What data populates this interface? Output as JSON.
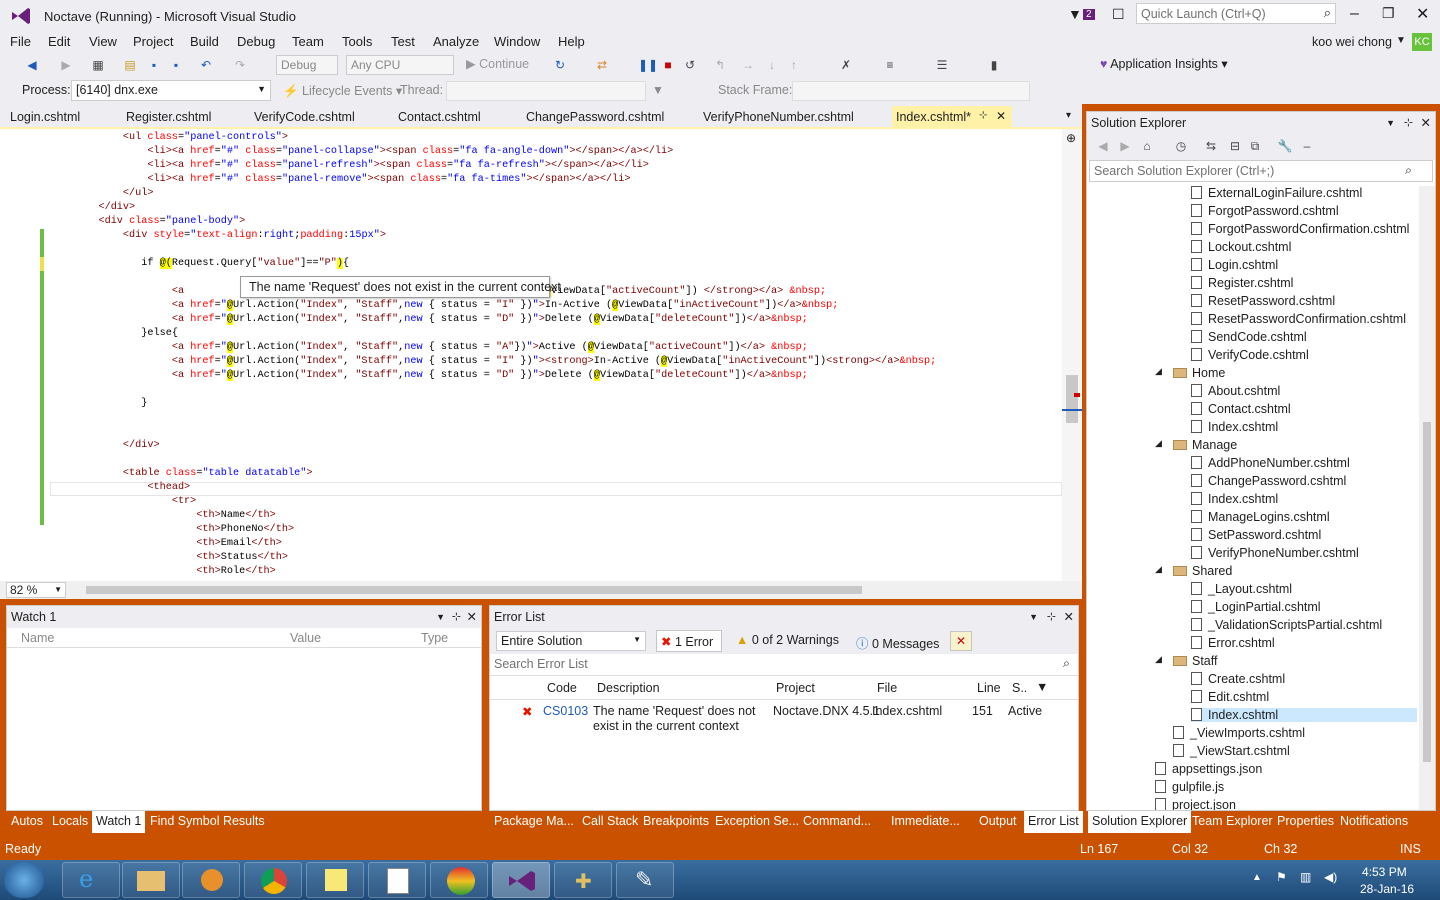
{
  "window": {
    "title": "Noctave (Running) - Microsoft Visual Studio",
    "notif_count": "2",
    "quick_launch": "Quick Launch (Ctrl+Q)",
    "user": "koo wei chong",
    "user_initials": "KC"
  },
  "menu": [
    "File",
    "Edit",
    "View",
    "Project",
    "Build",
    "Debug",
    "Team",
    "Tools",
    "Test",
    "Analyze",
    "Window",
    "Help"
  ],
  "toolbar": {
    "config": "Debug",
    "platform": "Any CPU",
    "continue": "Continue",
    "insights": "Application Insights"
  },
  "debugbar": {
    "process_label": "Process:",
    "process_value": "[6140] dnx.exe",
    "lifecycle": "Lifecycle Events",
    "thread_label": "Thread:",
    "stackframe_label": "Stack Frame:"
  },
  "doc_tabs": [
    "Login.cshtml",
    "Register.cshtml",
    "VerifyCode.cshtml",
    "Contact.cshtml",
    "ChangePassword.cshtml",
    "VerifyPhoneNumber.cshtml",
    "Index.cshtml*"
  ],
  "tooltip": "The name 'Request' does not exist in the current context",
  "zoom": "82 %",
  "watch": {
    "title": "Watch 1",
    "cols": [
      "Name",
      "Value",
      "Type"
    ]
  },
  "errors": {
    "title": "Error List",
    "scope": "Entire Solution",
    "errors_btn": "1 Error",
    "warnings_btn": "0 of 2 Warnings",
    "messages_btn": "0 Messages",
    "search": "Search Error List",
    "cols": [
      "Code",
      "Description",
      "Project",
      "File",
      "Line",
      "S.."
    ],
    "rows": [
      {
        "code": "CS0103",
        "desc1": "The name 'Request' does not",
        "desc2": "exist in the current context",
        "project": "Noctave.DNX 4.5.1",
        "file": "Index.cshtml",
        "line": "151",
        "state": "Active"
      }
    ]
  },
  "solution": {
    "title": "Solution Explorer",
    "search": "Search Solution Explorer (Ctrl+;)",
    "items": [
      "ExternalLoginFailure.cshtml",
      "ForgotPassword.cshtml",
      "ForgotPasswordConfirmation.cshtml",
      "Lockout.cshtml",
      "Login.cshtml",
      "Register.cshtml",
      "ResetPassword.cshtml",
      "ResetPasswordConfirmation.cshtml",
      "SendCode.cshtml",
      "VerifyCode.cshtml",
      "Home",
      "About.cshtml",
      "Contact.cshtml",
      "Index.cshtml",
      "Manage",
      "AddPhoneNumber.cshtml",
      "ChangePassword.cshtml",
      "Index.cshtml",
      "ManageLogins.cshtml",
      "SetPassword.cshtml",
      "VerifyPhoneNumber.cshtml",
      "Shared",
      "_Layout.cshtml",
      "_LoginPartial.cshtml",
      "_ValidationScriptsPartial.cshtml",
      "Error.cshtml",
      "Staff",
      "Create.cshtml",
      "Edit.cshtml",
      "Index.cshtml",
      "_ViewImports.cshtml",
      "_ViewStart.cshtml",
      "appsettings.json",
      "gulpfile.js",
      "project.json"
    ]
  },
  "bottom_tabs_left": [
    "Autos",
    "Locals",
    "Watch 1",
    "Find Symbol Results"
  ],
  "bottom_tabs_mid": [
    "Package Ma...",
    "Call Stack",
    "Breakpoints",
    "Exception Se...",
    "Command...",
    "Immediate...",
    "Output",
    "Error List"
  ],
  "bottom_tabs_right": [
    "Solution Explorer",
    "Team Explorer",
    "Properties",
    "Notifications"
  ],
  "status": {
    "ready": "Ready",
    "ln": "Ln 167",
    "col": "Col 32",
    "ch": "Ch 32",
    "ins": "INS"
  },
  "clock": {
    "time": "4:53 PM",
    "date": "28-Jan-16"
  },
  "accent": "#ca5100"
}
